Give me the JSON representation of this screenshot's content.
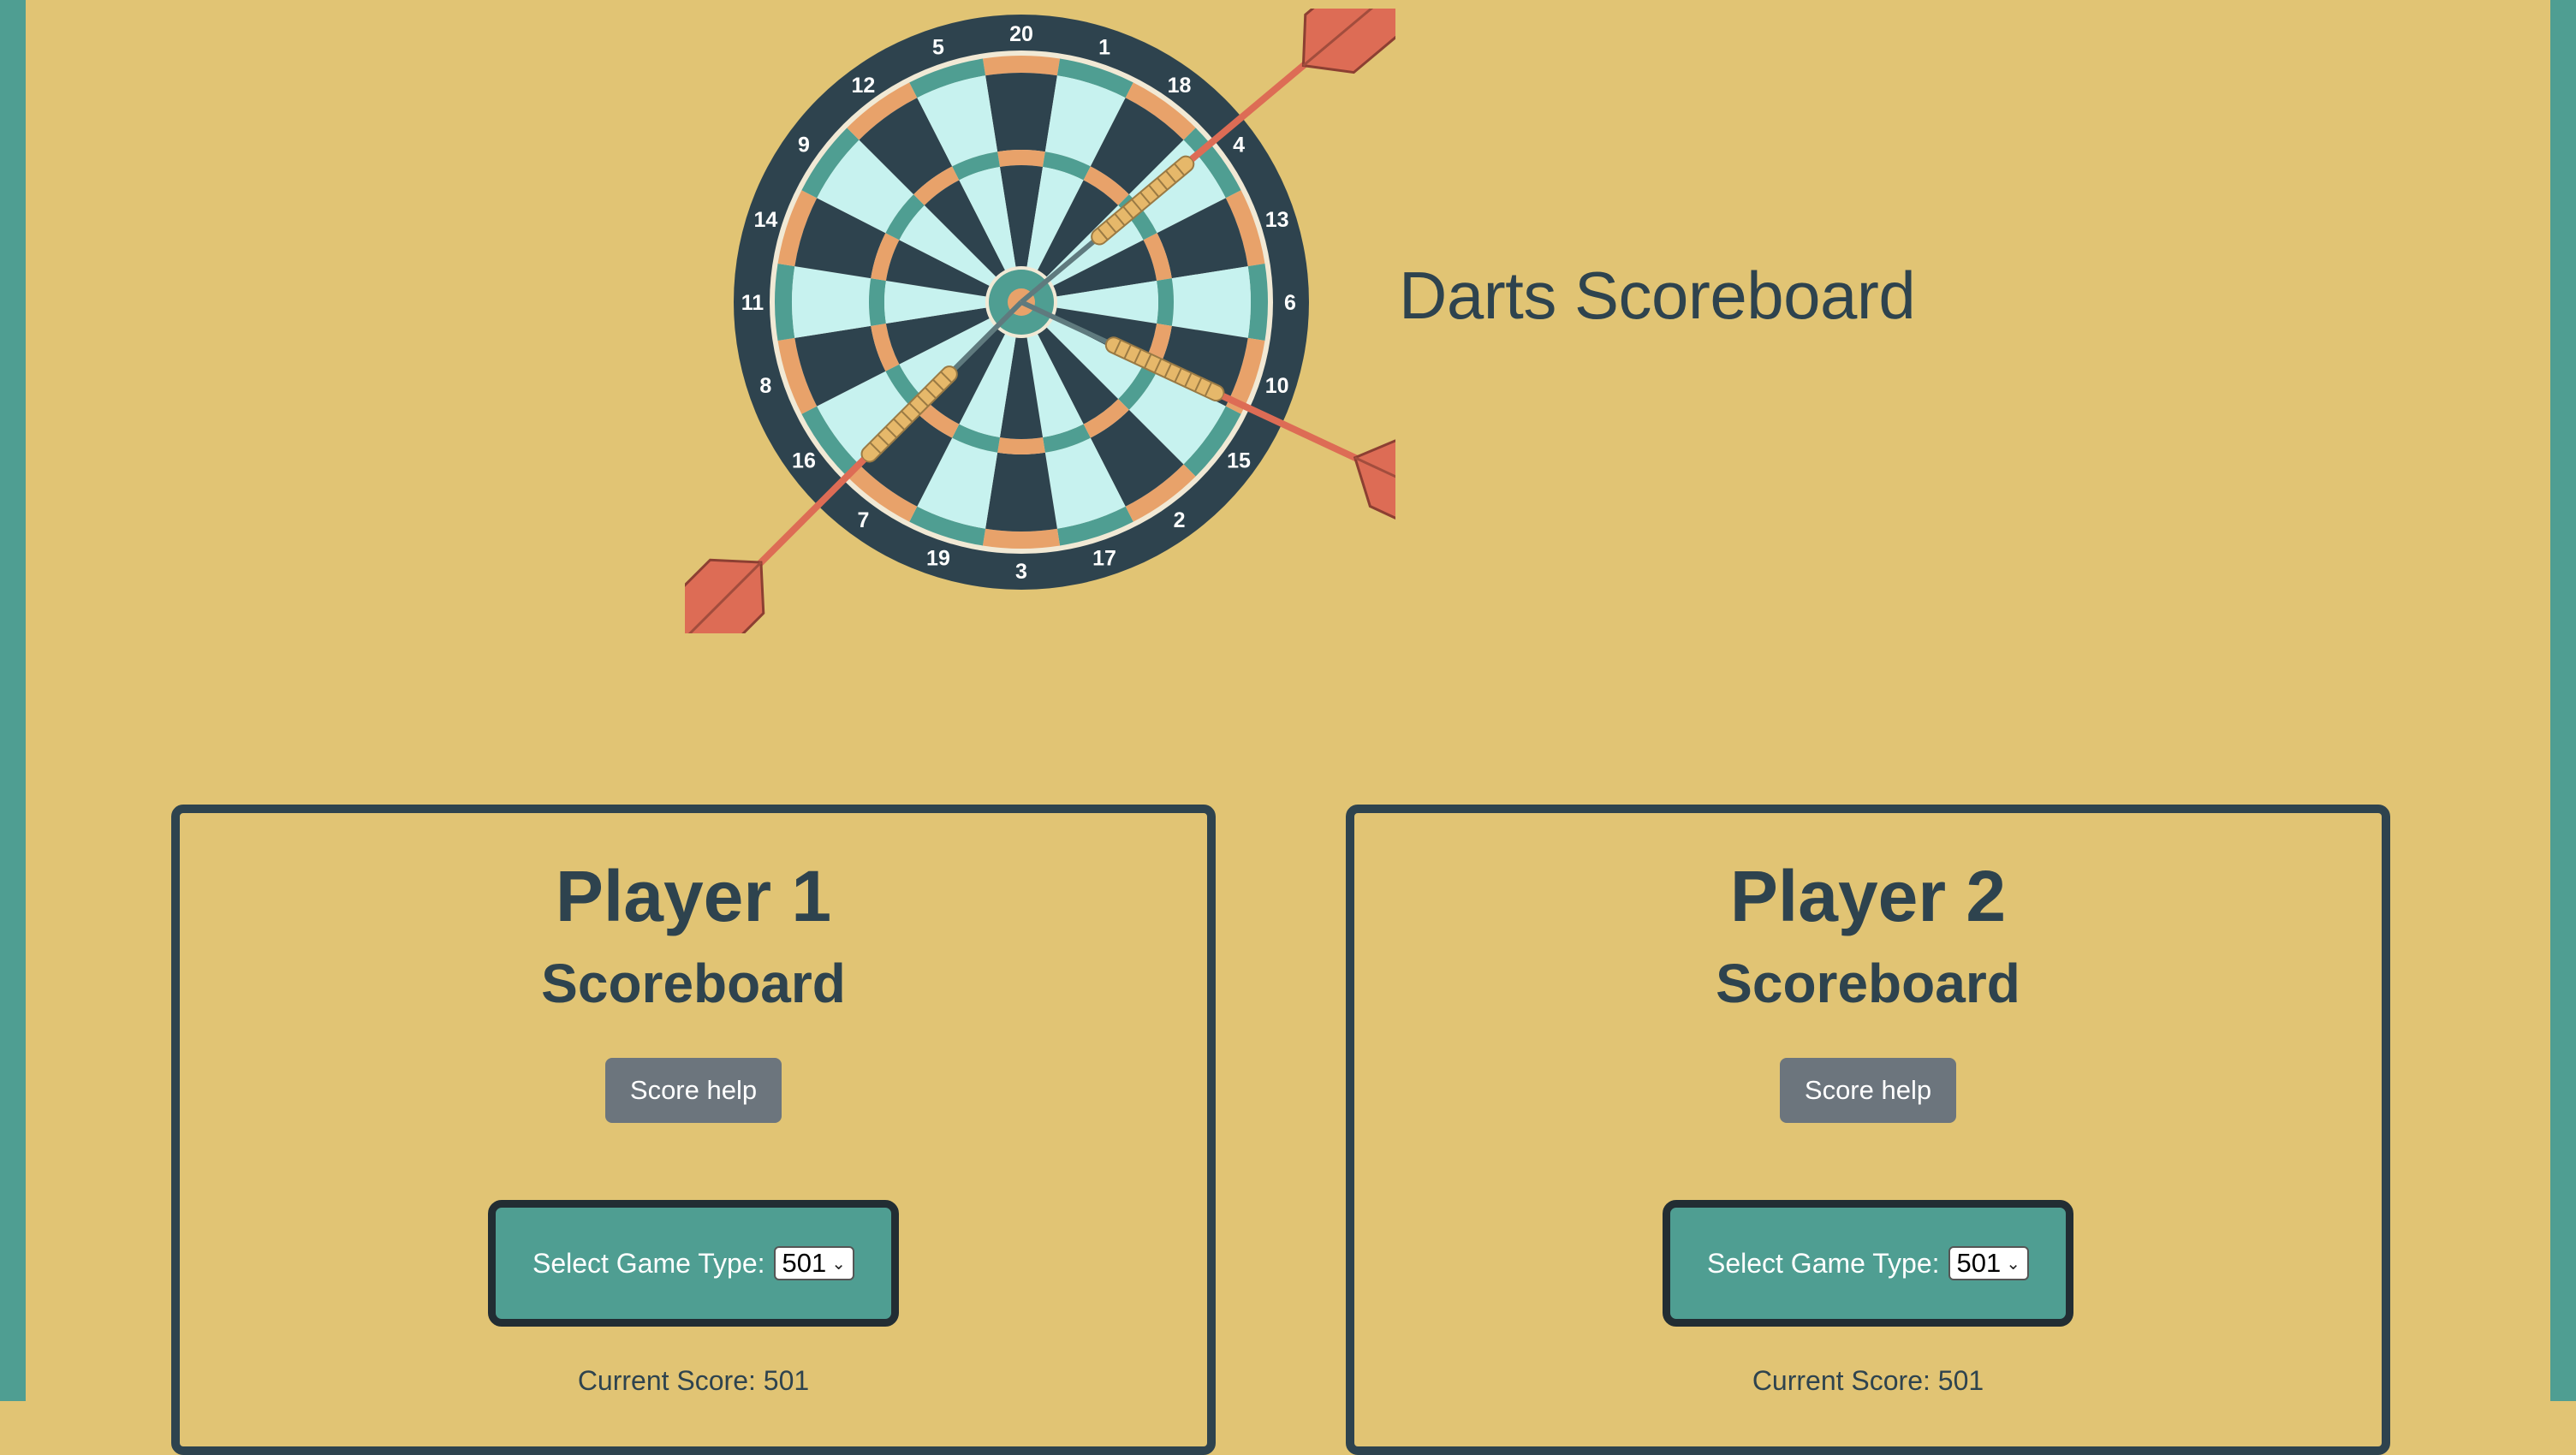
{
  "app": {
    "title": "Darts Scoreboard"
  },
  "dartboard": {
    "numbers": [
      "20",
      "1",
      "18",
      "4",
      "13",
      "6",
      "10",
      "15",
      "2",
      "17",
      "3",
      "19",
      "7",
      "16",
      "8",
      "11",
      "14",
      "9",
      "12",
      "5"
    ]
  },
  "players": [
    {
      "name": "Player 1",
      "subtitle": "Scoreboard",
      "help_label": "Score help",
      "game_type_label": "Select Game Type:",
      "game_type_value": "501",
      "current_score_text": "Current Score: 501"
    },
    {
      "name": "Player 2",
      "subtitle": "Scoreboard",
      "help_label": "Score help",
      "game_type_label": "Select Game Type:",
      "game_type_value": "501",
      "current_score_text": "Current Score: 501"
    }
  ],
  "colors": {
    "background": "#e1c474",
    "edge": "#4f9e92",
    "text": "#2e434e",
    "button": "#6c757d",
    "dart": "#dd6c55"
  }
}
